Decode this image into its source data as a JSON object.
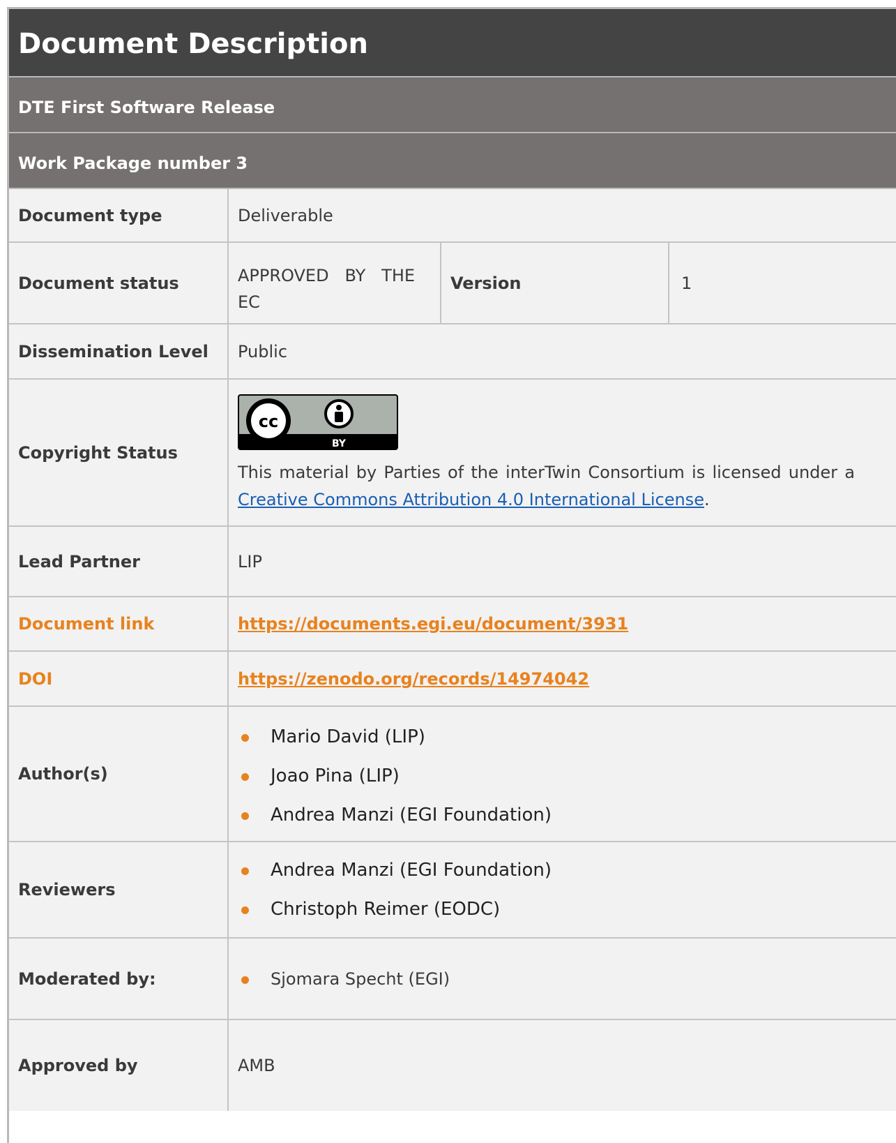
{
  "title": "Document Description",
  "subtitle": "DTE First Software Release",
  "work_package": "Work Package number 3",
  "rows": {
    "document_type": {
      "label": "Document type",
      "value": "Deliverable"
    },
    "document_status": {
      "label": "Document status",
      "value_line1": "APPROVED   BY   THE",
      "value_line2": "EC",
      "version_label": "Version",
      "version_value": "1"
    },
    "dissemination": {
      "label": "Dissemination Level",
      "value": "Public"
    },
    "copyright": {
      "label": "Copyright Status",
      "badge_text": "BY",
      "license_text": "This material by Parties of the interTwin Consortium is licensed under a ",
      "license_link": "Creative Commons Attribution 4.0 International License",
      "license_end": "."
    },
    "lead_partner": {
      "label": "Lead Partner",
      "value": "LIP"
    },
    "document_link": {
      "label": "Document link",
      "value": "https://documents.egi.eu/document/3931"
    },
    "doi": {
      "label": "DOI",
      "value": "https://zenodo.org/records/14974042"
    },
    "authors": {
      "label": "Author(s)",
      "items": [
        "Mario David (LIP)",
        "Joao Pina (LIP)",
        "Andrea Manzi (EGI Foundation)"
      ]
    },
    "reviewers": {
      "label": "Reviewers",
      "items": [
        "Andrea Manzi (EGI Foundation)",
        "Christoph Reimer (EODC)"
      ]
    },
    "moderated_by": {
      "label": "Moderated by:",
      "items": [
        "Sjomara Specht (EGI)"
      ]
    },
    "approved_by": {
      "label": "Approved by",
      "value": "AMB"
    }
  },
  "colors": {
    "title_band": "#444444",
    "sub_band": "#757170",
    "accent": "#e8821e",
    "link": "#1a5fb4",
    "cell_bg": "#f2f2f2"
  }
}
